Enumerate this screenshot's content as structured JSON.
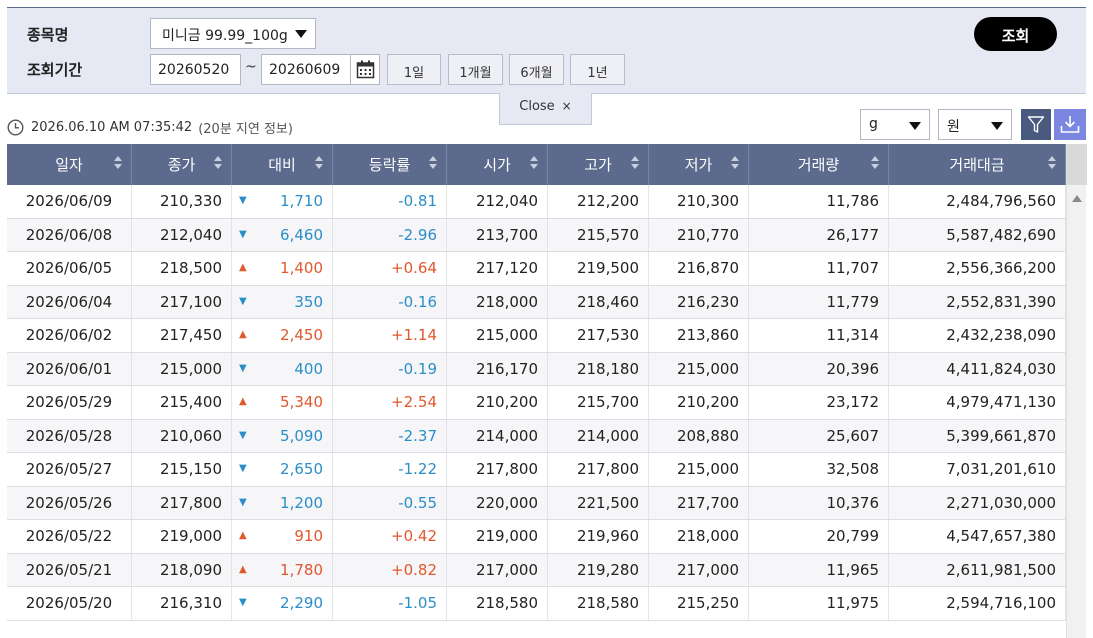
{
  "search": {
    "product_label": "종목명",
    "period_label": "조회기간",
    "product_value": "미니금 99.99_100g",
    "start_date": "20260520",
    "date_separator": "~",
    "end_date": "20260609",
    "period_buttons": [
      "1일",
      "1개월",
      "6개월",
      "1년"
    ],
    "search_button": "조회"
  },
  "close_tab": {
    "label": "Close",
    "icon": "×"
  },
  "info": {
    "timestamp": "2026.06.10 AM 07:35:42",
    "delay_note": "(20분 지연 정보)"
  },
  "units": {
    "weight": "g",
    "currency": "원"
  },
  "colors": {
    "up": "#e1582c",
    "down": "#2a8ec8",
    "header": "#5b6a8d",
    "download": "#7b86e0"
  },
  "table": {
    "headers": [
      "일자",
      "종가",
      "대비",
      "등락률",
      "시가",
      "고가",
      "저가",
      "거래량",
      "거래대금"
    ],
    "rows": [
      {
        "date": "2026/06/09",
        "close": "210,330",
        "dir": "down",
        "arrow": "▼",
        "change": "1,710",
        "rate": "-0.81",
        "open": "212,040",
        "high": "212,200",
        "low": "210,300",
        "volume": "11,786",
        "value": "2,484,796,560"
      },
      {
        "date": "2026/06/08",
        "close": "212,040",
        "dir": "down",
        "arrow": "▼",
        "change": "6,460",
        "rate": "-2.96",
        "open": "213,700",
        "high": "215,570",
        "low": "210,770",
        "volume": "26,177",
        "value": "5,587,482,690"
      },
      {
        "date": "2026/06/05",
        "close": "218,500",
        "dir": "up",
        "arrow": "▲",
        "change": "1,400",
        "rate": "+0.64",
        "open": "217,120",
        "high": "219,500",
        "low": "216,870",
        "volume": "11,707",
        "value": "2,556,366,200"
      },
      {
        "date": "2026/06/04",
        "close": "217,100",
        "dir": "down",
        "arrow": "▼",
        "change": "350",
        "rate": "-0.16",
        "open": "218,000",
        "high": "218,460",
        "low": "216,230",
        "volume": "11,779",
        "value": "2,552,831,390"
      },
      {
        "date": "2026/06/02",
        "close": "217,450",
        "dir": "up",
        "arrow": "▲",
        "change": "2,450",
        "rate": "+1.14",
        "open": "215,000",
        "high": "217,530",
        "low": "213,860",
        "volume": "11,314",
        "value": "2,432,238,090"
      },
      {
        "date": "2026/06/01",
        "close": "215,000",
        "dir": "down",
        "arrow": "▼",
        "change": "400",
        "rate": "-0.19",
        "open": "216,170",
        "high": "218,180",
        "low": "215,000",
        "volume": "20,396",
        "value": "4,411,824,030"
      },
      {
        "date": "2026/05/29",
        "close": "215,400",
        "dir": "up",
        "arrow": "▲",
        "change": "5,340",
        "rate": "+2.54",
        "open": "210,200",
        "high": "215,700",
        "low": "210,200",
        "volume": "23,172",
        "value": "4,979,471,130"
      },
      {
        "date": "2026/05/28",
        "close": "210,060",
        "dir": "down",
        "arrow": "▼",
        "change": "5,090",
        "rate": "-2.37",
        "open": "214,000",
        "high": "214,000",
        "low": "208,880",
        "volume": "25,607",
        "value": "5,399,661,870"
      },
      {
        "date": "2026/05/27",
        "close": "215,150",
        "dir": "down",
        "arrow": "▼",
        "change": "2,650",
        "rate": "-1.22",
        "open": "217,800",
        "high": "217,800",
        "low": "215,000",
        "volume": "32,508",
        "value": "7,031,201,610"
      },
      {
        "date": "2026/05/26",
        "close": "217,800",
        "dir": "down",
        "arrow": "▼",
        "change": "1,200",
        "rate": "-0.55",
        "open": "220,000",
        "high": "221,500",
        "low": "217,700",
        "volume": "10,376",
        "value": "2,271,030,000"
      },
      {
        "date": "2026/05/22",
        "close": "219,000",
        "dir": "up",
        "arrow": "▲",
        "change": "910",
        "rate": "+0.42",
        "open": "219,000",
        "high": "219,960",
        "low": "218,000",
        "volume": "20,799",
        "value": "4,547,657,380"
      },
      {
        "date": "2026/05/21",
        "close": "218,090",
        "dir": "up",
        "arrow": "▲",
        "change": "1,780",
        "rate": "+0.82",
        "open": "217,000",
        "high": "219,280",
        "low": "217,000",
        "volume": "11,965",
        "value": "2,611,981,500"
      },
      {
        "date": "2026/05/20",
        "close": "216,310",
        "dir": "down",
        "arrow": "▼",
        "change": "2,290",
        "rate": "-1.05",
        "open": "218,580",
        "high": "218,580",
        "low": "215,250",
        "volume": "11,975",
        "value": "2,594,716,100"
      }
    ]
  }
}
